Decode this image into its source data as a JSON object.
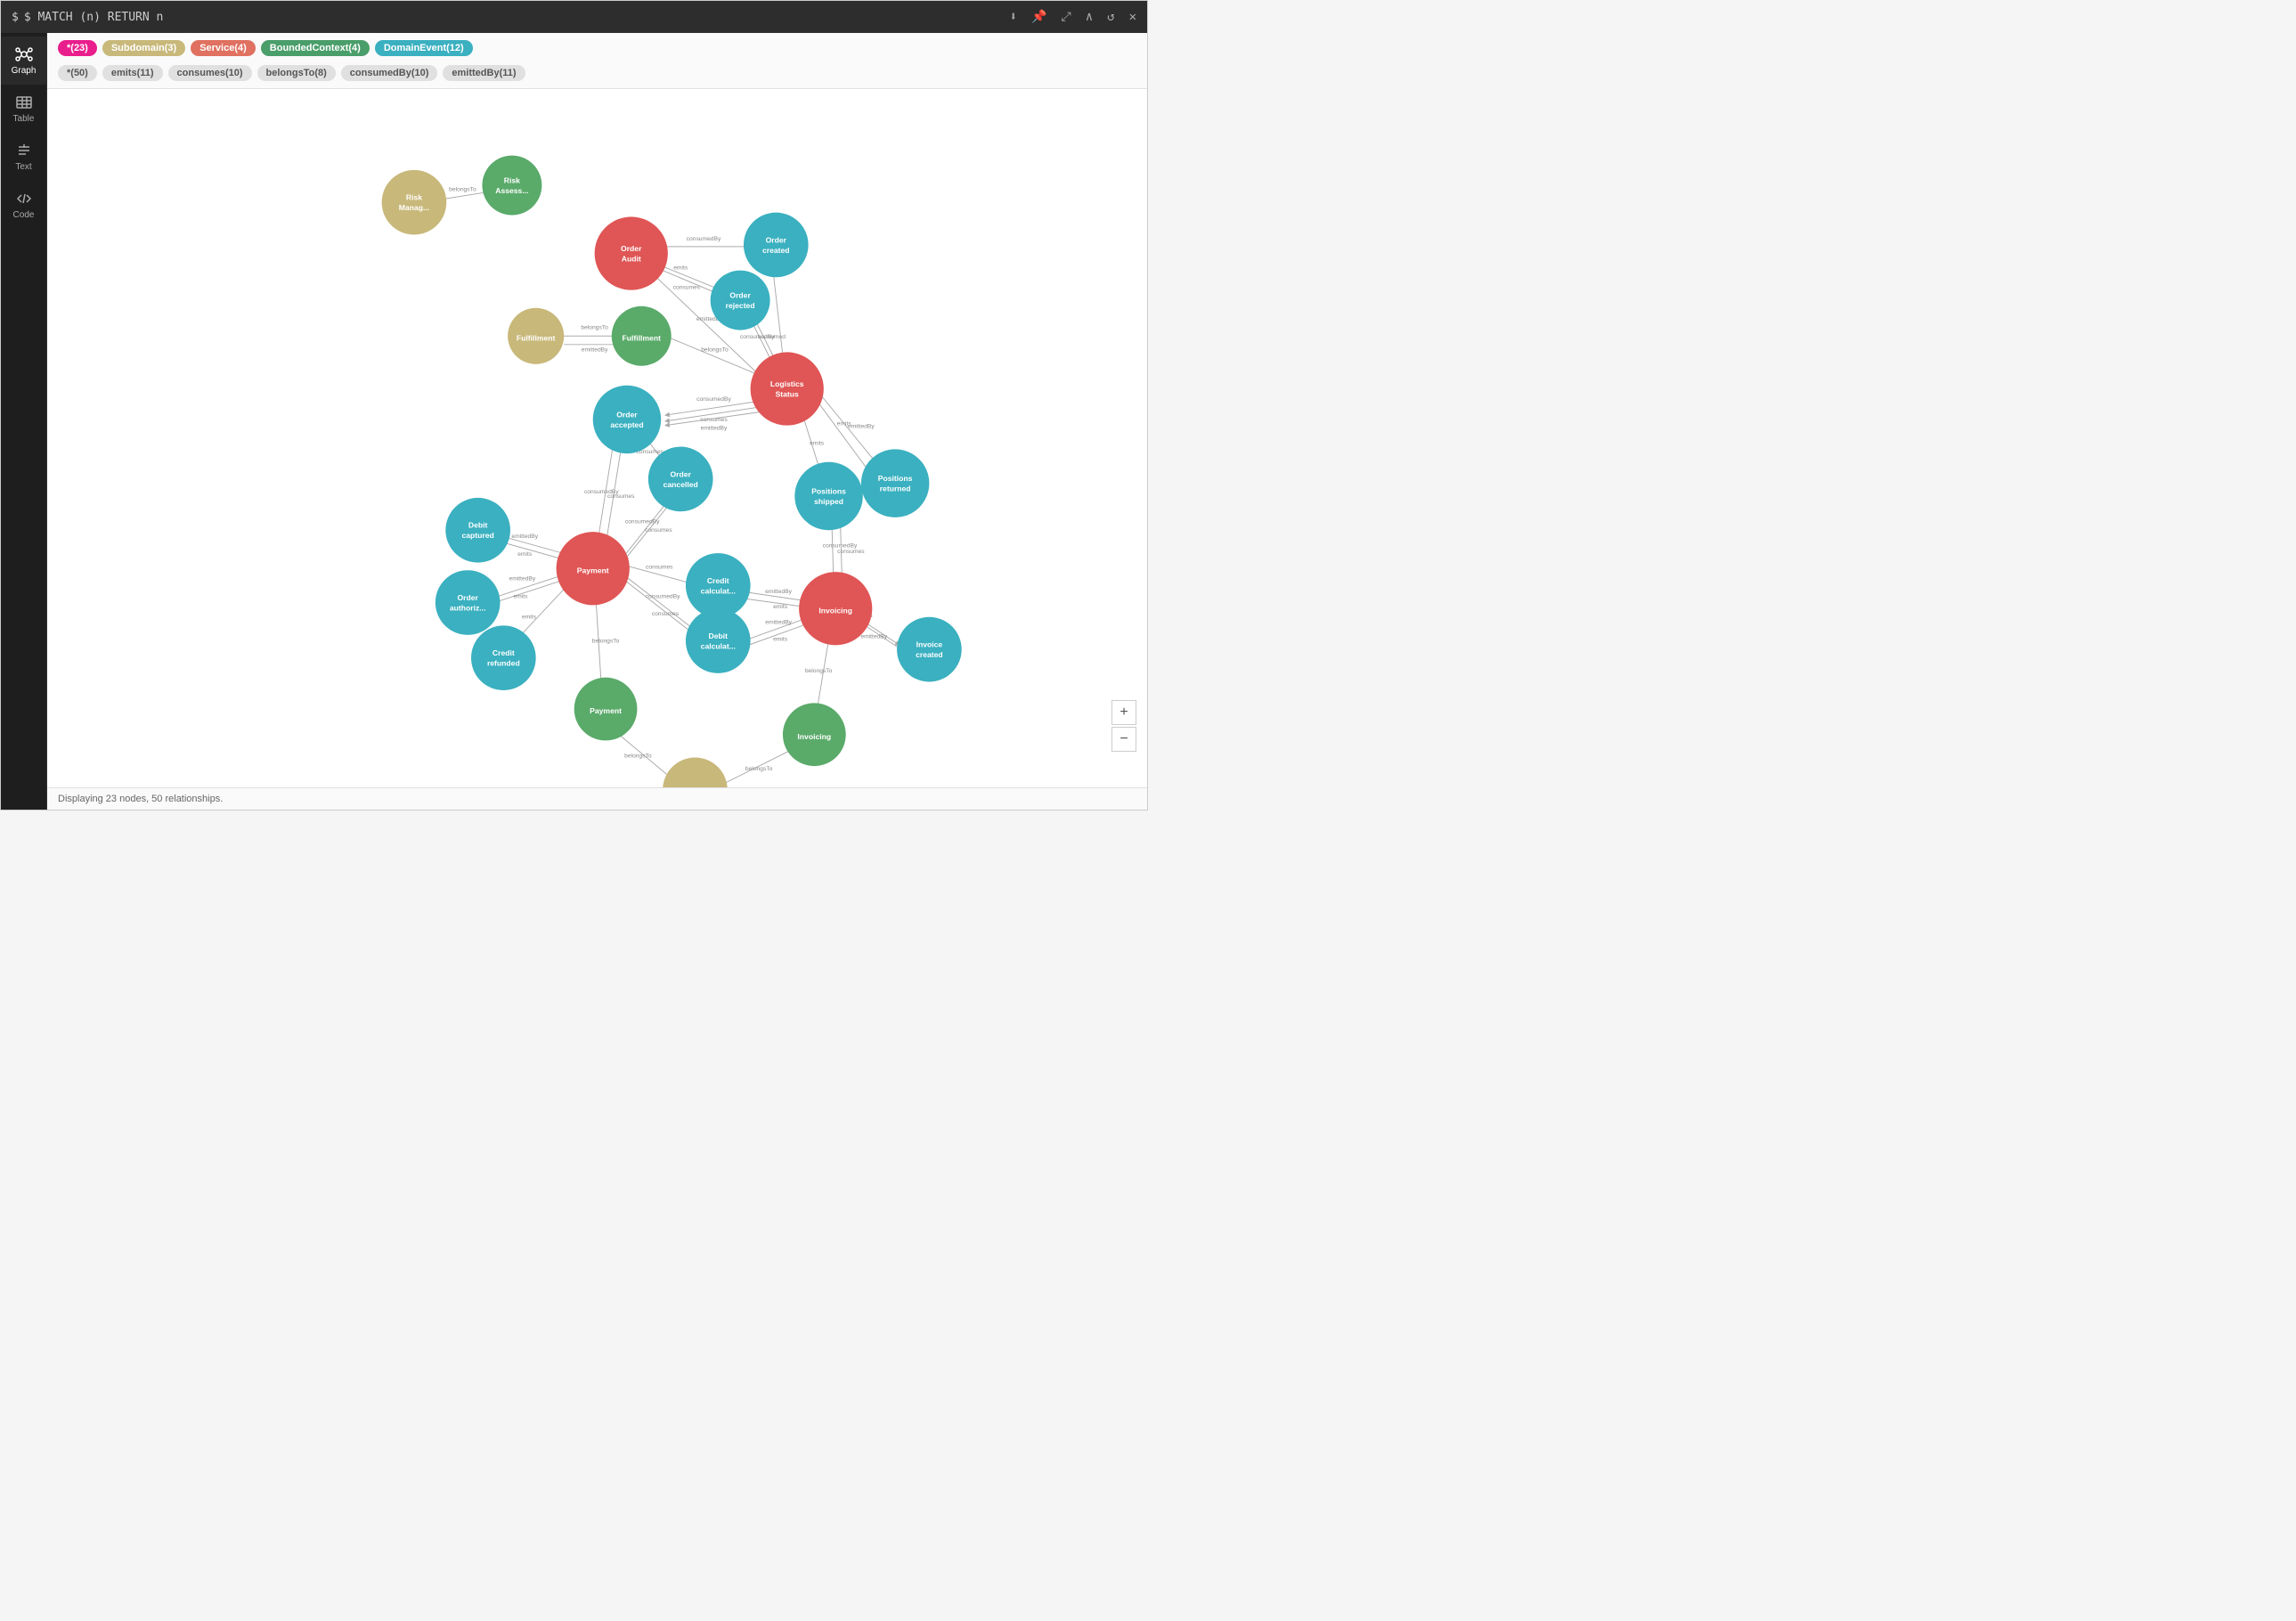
{
  "titlebar": {
    "query": "$ MATCH (n) RETURN n",
    "icons": [
      "download",
      "pin",
      "expand",
      "chevron-up",
      "refresh",
      "close"
    ]
  },
  "sidebar": {
    "items": [
      {
        "id": "graph",
        "label": "Graph",
        "active": true
      },
      {
        "id": "table",
        "label": "Table",
        "active": false
      },
      {
        "id": "text",
        "label": "Text",
        "active": false
      },
      {
        "id": "code",
        "label": "Code",
        "active": false
      }
    ]
  },
  "filter_row1": [
    {
      "label": "*(23)",
      "type": "pink"
    },
    {
      "label": "Subdomain(3)",
      "type": "tan"
    },
    {
      "label": "Service(4)",
      "type": "coral"
    },
    {
      "label": "BoundedContext(4)",
      "type": "green"
    },
    {
      "label": "DomainEvent(12)",
      "type": "teal"
    }
  ],
  "filter_row2": [
    {
      "label": "*(50)",
      "type": "gray"
    },
    {
      "label": "emits(11)",
      "type": "gray"
    },
    {
      "label": "consumes(10)",
      "type": "gray"
    },
    {
      "label": "belongsTo(8)",
      "type": "gray"
    },
    {
      "label": "consumedBy(10)",
      "type": "gray"
    },
    {
      "label": "emittedBy(11)",
      "type": "gray"
    }
  ],
  "status_bar": "Displaying 23 nodes, 50 relationships.",
  "zoom": {
    "in": "+",
    "out": "−"
  }
}
